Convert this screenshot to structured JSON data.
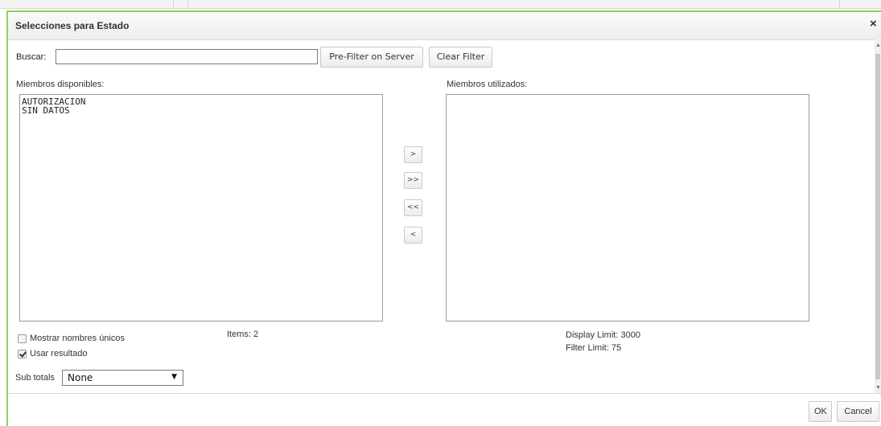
{
  "dialog": {
    "title": "Selecciones para Estado",
    "close_glyph": "×"
  },
  "search": {
    "label": "Buscar:",
    "value": "",
    "placeholder": ""
  },
  "buttons": {
    "prefilter": "Pre-Filter on Server",
    "clear_filter": "Clear Filter",
    "ok": "OK",
    "cancel": "Cancel"
  },
  "available": {
    "label": "Miembros disponibles:",
    "items": [
      "AUTORIZACION",
      "SIN DATOS"
    ],
    "count_text": "Items: 2"
  },
  "used": {
    "label": "Miembros utilizados:",
    "items": [],
    "display_limit": "Display Limit: 3000",
    "filter_limit": "Filter Limit: 75"
  },
  "move_buttons": {
    "add": ">",
    "add_all": ">>",
    "remove_all": "<<",
    "remove": "<"
  },
  "options": {
    "unique_names": {
      "label": "Mostrar nombres únicos",
      "checked": false
    },
    "use_result": {
      "label": "Usar resultado",
      "checked": true
    }
  },
  "subtotals": {
    "label": "Sub totals",
    "selected": "None"
  },
  "icons": {
    "caret": "▼",
    "scroll_up": "▲",
    "scroll_down": "▼"
  },
  "colors": {
    "dialog_border": "#8ed463"
  }
}
